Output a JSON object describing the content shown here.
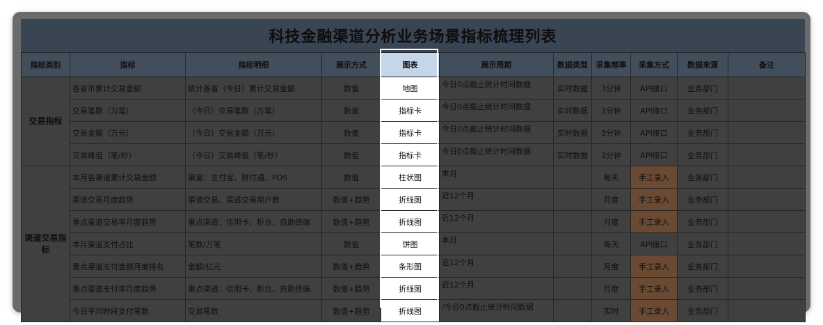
{
  "title": "科技金融渠道分析业务场景指标梳理列表",
  "headers": [
    "指标类别",
    "指标",
    "指标明细",
    "展示方式",
    "图表",
    "展示周期",
    "数据类型",
    "采集频率",
    "采集方式",
    "数据来源",
    "备注"
  ],
  "groups": [
    {
      "category": "交易指标",
      "rows": [
        {
          "metric": "各省市累计交易金额",
          "detail": "统计各省（今日）累计交易金额",
          "display": "数值",
          "chart": "地图",
          "period": "今日0点截止统计时间数据",
          "dtype": "实时数据",
          "freq": "3分钟",
          "method": "API接口",
          "manual": false,
          "source": "业务部门",
          "note": ""
        },
        {
          "metric": "交易笔数（万笔）",
          "detail": "（今日）交易笔数（万笔）",
          "display": "数值",
          "chart": "指标卡",
          "period": "今日0点截止统计时间数据",
          "dtype": "实时数据",
          "freq": "3分钟",
          "method": "API接口",
          "manual": false,
          "source": "业务部门",
          "note": ""
        },
        {
          "metric": "交易金额（万元）",
          "detail": "（今日）交易金额（万元）",
          "display": "数值",
          "chart": "指标卡",
          "period": "今日0点截止统计时间数据",
          "dtype": "实时数据",
          "freq": "3分钟",
          "method": "API接口",
          "manual": false,
          "source": "业务部门",
          "note": ""
        },
        {
          "metric": "交易峰值（笔/秒）",
          "detail": "（今日）交易峰值（笔/秒）",
          "display": "数值",
          "chart": "指标卡",
          "period": "今日0点截止统计时间数据",
          "dtype": "实时数据",
          "freq": "3分钟",
          "method": "API接口",
          "manual": false,
          "source": "业务部门",
          "note": ""
        }
      ]
    },
    {
      "category": "渠道交易指标",
      "rows": [
        {
          "metric": "本月各渠道累计交易金额",
          "detail": "渠道：支付宝、财付通、POS",
          "display": "数值",
          "chart": "柱状图",
          "period": "本月",
          "dtype": "",
          "freq": "每天",
          "method": "手工录入",
          "manual": true,
          "source": "业务部门",
          "note": ""
        },
        {
          "metric": "渠道交易月度趋势",
          "detail": "渠道交易、渠道交易用户数",
          "display": "数值+趋势",
          "chart": "折线图",
          "period": "近12个月",
          "dtype": "",
          "freq": "月度",
          "method": "手工录入",
          "manual": true,
          "source": "业务部门",
          "note": ""
        },
        {
          "metric": "重点渠道交易率月度趋势",
          "detail": "重点渠道：信用卡、柜台、自助终端",
          "display": "数值+趋势",
          "chart": "折线图",
          "period": "近12个月",
          "dtype": "",
          "freq": "月度",
          "method": "手工录入",
          "manual": true,
          "source": "业务部门",
          "note": ""
        },
        {
          "metric": "本月渠道支付占比",
          "detail": "笔数/万笔",
          "display": "数值",
          "chart": "饼图",
          "period": "本月",
          "dtype": "",
          "freq": "每天",
          "method": "API接口",
          "manual": false,
          "source": "业务部门",
          "note": ""
        },
        {
          "metric": "重点渠道支付金额月度排名",
          "detail": "金额/亿元",
          "display": "数值+趋势",
          "chart": "条形图",
          "period": "近12个月",
          "dtype": "",
          "freq": "月度",
          "method": "手工录入",
          "manual": true,
          "source": "业务部门",
          "note": ""
        },
        {
          "metric": "重点渠道支付率月度趋势",
          "detail": "重点渠道：信用卡、柜台、自助终端",
          "display": "数值+趋势",
          "chart": "折线图",
          "period": "近12个月",
          "dtype": "",
          "freq": "月度",
          "method": "手工录入",
          "manual": true,
          "source": "业务部门",
          "note": ""
        },
        {
          "metric": "今日平均时段支付笔数",
          "detail": "交易笔数",
          "display": "数值+趋势",
          "chart": "折线图",
          "period": "/今日0点截止统计时间数据",
          "dtype": "",
          "freq": "实时",
          "method": "手工录入",
          "manual": true,
          "source": "业务部门",
          "note": ""
        }
      ]
    }
  ]
}
